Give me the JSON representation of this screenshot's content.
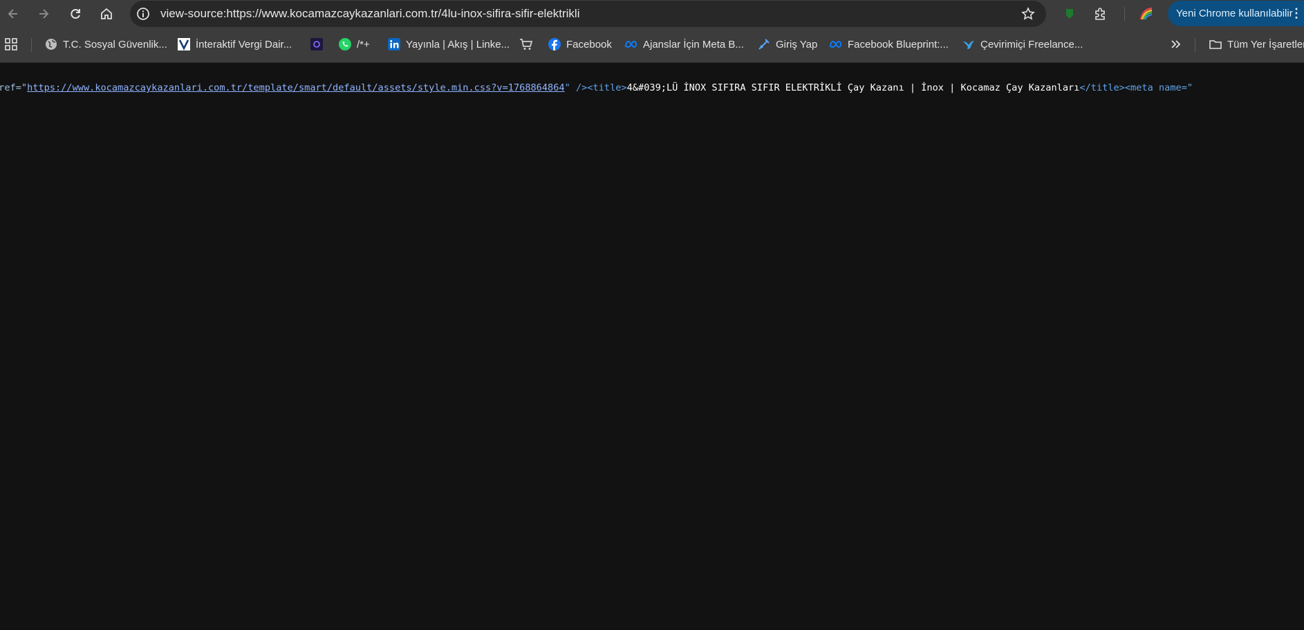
{
  "toolbar": {
    "url": "view-source:https://www.kocamazcaykazanlari.com.tr/4lu-inox-sifira-sifir-elektrikli",
    "update_label": "Yeni Chrome kullanılabilir"
  },
  "bookmarks": [
    {
      "label": "T.C. Sosyal Güvenlik..."
    },
    {
      "label": "İnteraktif Vergi Dair..."
    },
    {
      "label": ""
    },
    {
      "label": "/*+"
    },
    {
      "label": "Yayınla | Akış | Linke..."
    },
    {
      "label": ""
    },
    {
      "label": "Facebook"
    },
    {
      "label": "Ajanslar İçin Meta B..."
    },
    {
      "label": "Giriş Yap"
    },
    {
      "label": "Facebook Blueprint:..."
    },
    {
      "label": "Çevirimiçi Freelance..."
    }
  ],
  "all_bookmarks_label": "Tüm Yer İşaretleri",
  "source": {
    "attr_name": "href=",
    "quote_open": "\"",
    "link": "https://www.kocamazcaykazanlari.com.tr/template/smart/default/assets/style.min.css?v=1768864864",
    "tag_close": "\" />",
    "title_open": "<title>",
    "title_text": "4&#039;LÜ İNOX SIFIRA SIFIR ELEKTRİKLİ Çay Kazanı | İnox | Kocamaz Çay Kazanları",
    "title_close": "</title>",
    "meta_open": "<meta name=\""
  },
  "colors": {
    "toolbar_bg": "#3c3c3c",
    "page_bg": "#121212",
    "update_button_bg": "#0b4f83"
  }
}
